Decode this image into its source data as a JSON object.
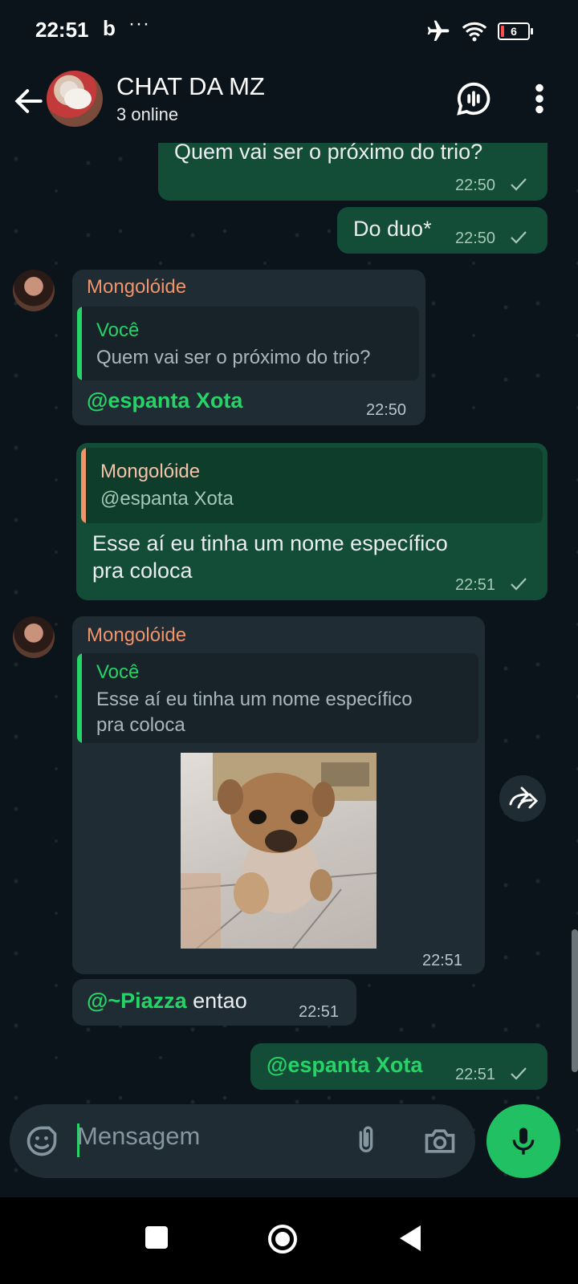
{
  "status_bar": {
    "time": "22:51",
    "app_badge": "b",
    "more": "···",
    "battery": "6"
  },
  "header": {
    "title": "CHAT DA MZ",
    "subtitle": "3 online"
  },
  "messages": [
    {
      "dir": "out",
      "text": "Quem vai ser o próximo do trio?",
      "time": "22:50"
    },
    {
      "dir": "out",
      "text": "Do duo*",
      "time": "22:50"
    },
    {
      "dir": "in",
      "sender": "Mongolóide",
      "quote_name": "Você",
      "quote_text": "Quem vai ser o próximo do trio?",
      "text": "@espanta Xota",
      "time": "22:50"
    },
    {
      "dir": "out",
      "quote_name": "Mongolóide",
      "quote_text": "@espanta Xota",
      "text_line1": "Esse aí eu tinha um nome específico",
      "text_line2": "pra coloca",
      "time": "22:51"
    },
    {
      "dir": "in",
      "sender": "Mongolóide",
      "quote_name": "Você",
      "quote_line1": "Esse aí eu tinha um nome específico",
      "quote_line2": "pra coloca",
      "media": "sticker-dog",
      "time": "22:51"
    },
    {
      "dir": "in",
      "mention": "@~Piazza",
      "text": " entao",
      "time": "22:51"
    },
    {
      "dir": "out",
      "text": "@espanta Xota",
      "time": "22:51"
    }
  ],
  "composer": {
    "placeholder": "Mensagem"
  },
  "colors": {
    "out_bubble": "#144d37",
    "in_bubble": "#1f2c34",
    "accent": "#25d366",
    "sender": "#f2946a"
  }
}
